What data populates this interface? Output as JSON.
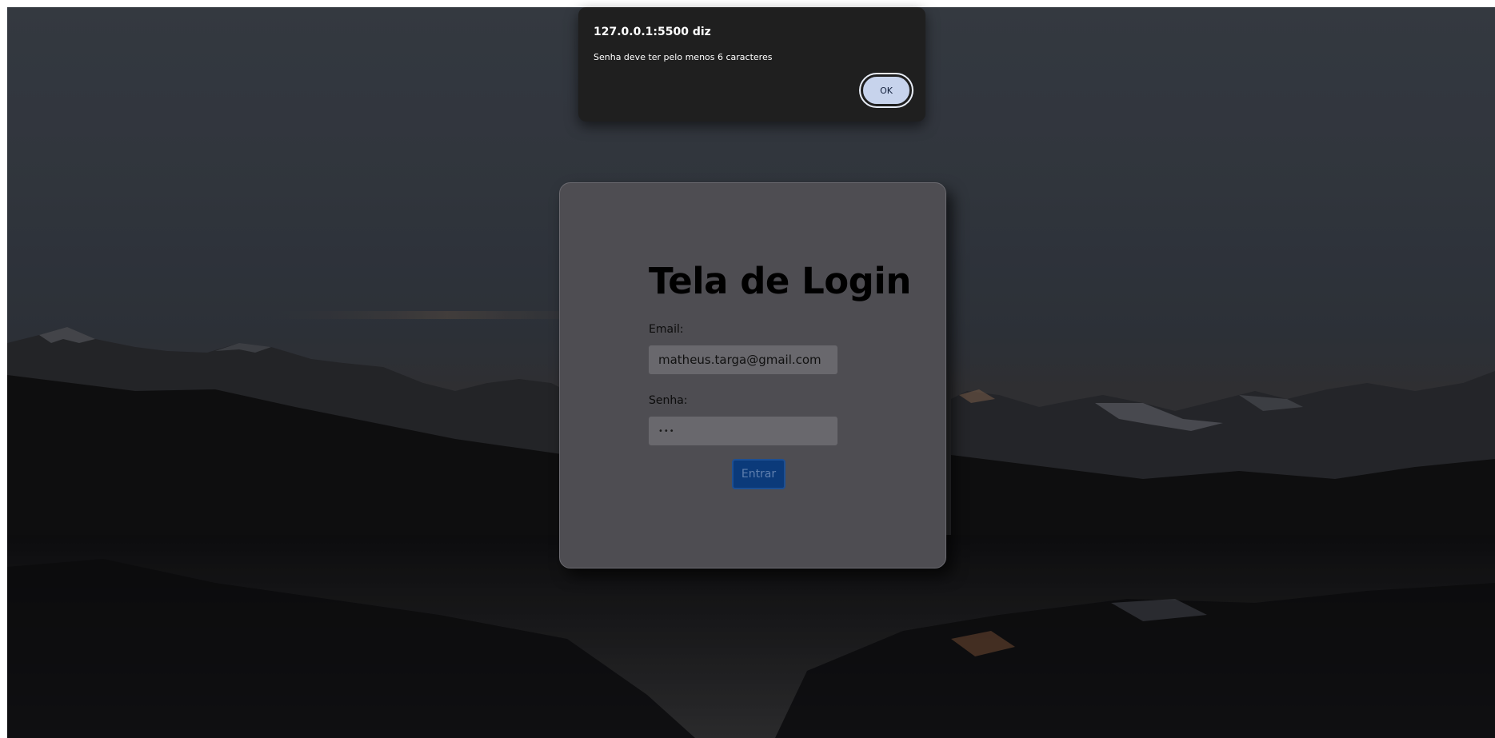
{
  "alert": {
    "title": "127.0.0.1:5500 diz",
    "message": "Senha deve ter pelo menos 6 caracteres",
    "ok_label": "OK"
  },
  "login": {
    "title": "Tela de Login",
    "email_label": "Email:",
    "email_value": "matheus.targa@gmail.com",
    "password_label": "Senha:",
    "password_mask": "•••",
    "submit_label": "Entrar"
  },
  "colors": {
    "card_background": "#4e4d52",
    "submit_button": "#0b3a7a",
    "alert_background": "#1f1f1f",
    "alert_ok_button": "#c7d3ec"
  }
}
